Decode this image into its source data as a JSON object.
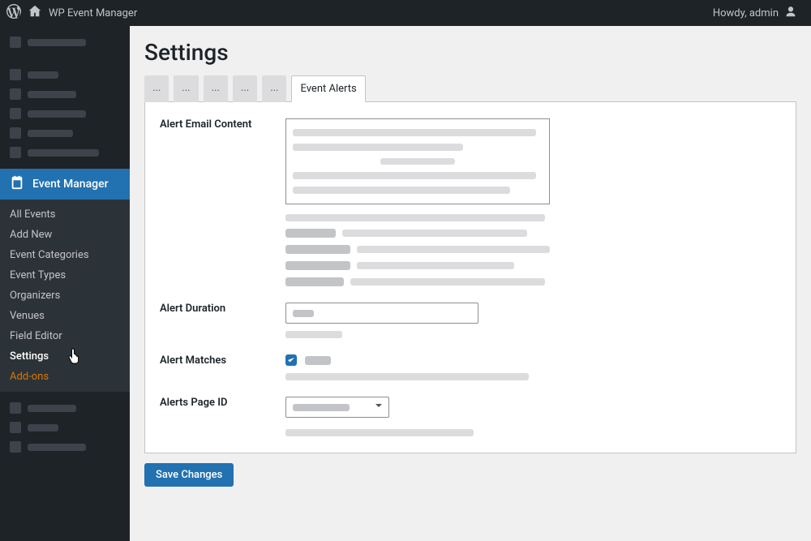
{
  "adminbar": {
    "site_name": "WP Event Manager",
    "greeting": "Howdy, admin"
  },
  "sidebar": {
    "active_menu": "Event Manager",
    "submenu": [
      {
        "label": "All Events",
        "current": false,
        "addon": false
      },
      {
        "label": "Add New",
        "current": false,
        "addon": false
      },
      {
        "label": "Event Categories",
        "current": false,
        "addon": false
      },
      {
        "label": "Event Types",
        "current": false,
        "addon": false
      },
      {
        "label": "Organizers",
        "current": false,
        "addon": false
      },
      {
        "label": "Venues",
        "current": false,
        "addon": false
      },
      {
        "label": "Field Editor",
        "current": false,
        "addon": false
      },
      {
        "label": "Settings",
        "current": true,
        "addon": false
      },
      {
        "label": "Add-ons",
        "current": false,
        "addon": true
      }
    ]
  },
  "page": {
    "title": "Settings",
    "tabs": [
      "...",
      "...",
      "...",
      "...",
      "...",
      "Event Alerts"
    ],
    "active_tab": 5,
    "fields": {
      "alert_email_content_label": "Alert Email Content",
      "alert_duration_label": "Alert Duration",
      "alert_matches_label": "Alert Matches",
      "alerts_page_id_label": "Alerts Page ID",
      "alert_matches_checked": true
    },
    "save_label": "Save Changes"
  }
}
